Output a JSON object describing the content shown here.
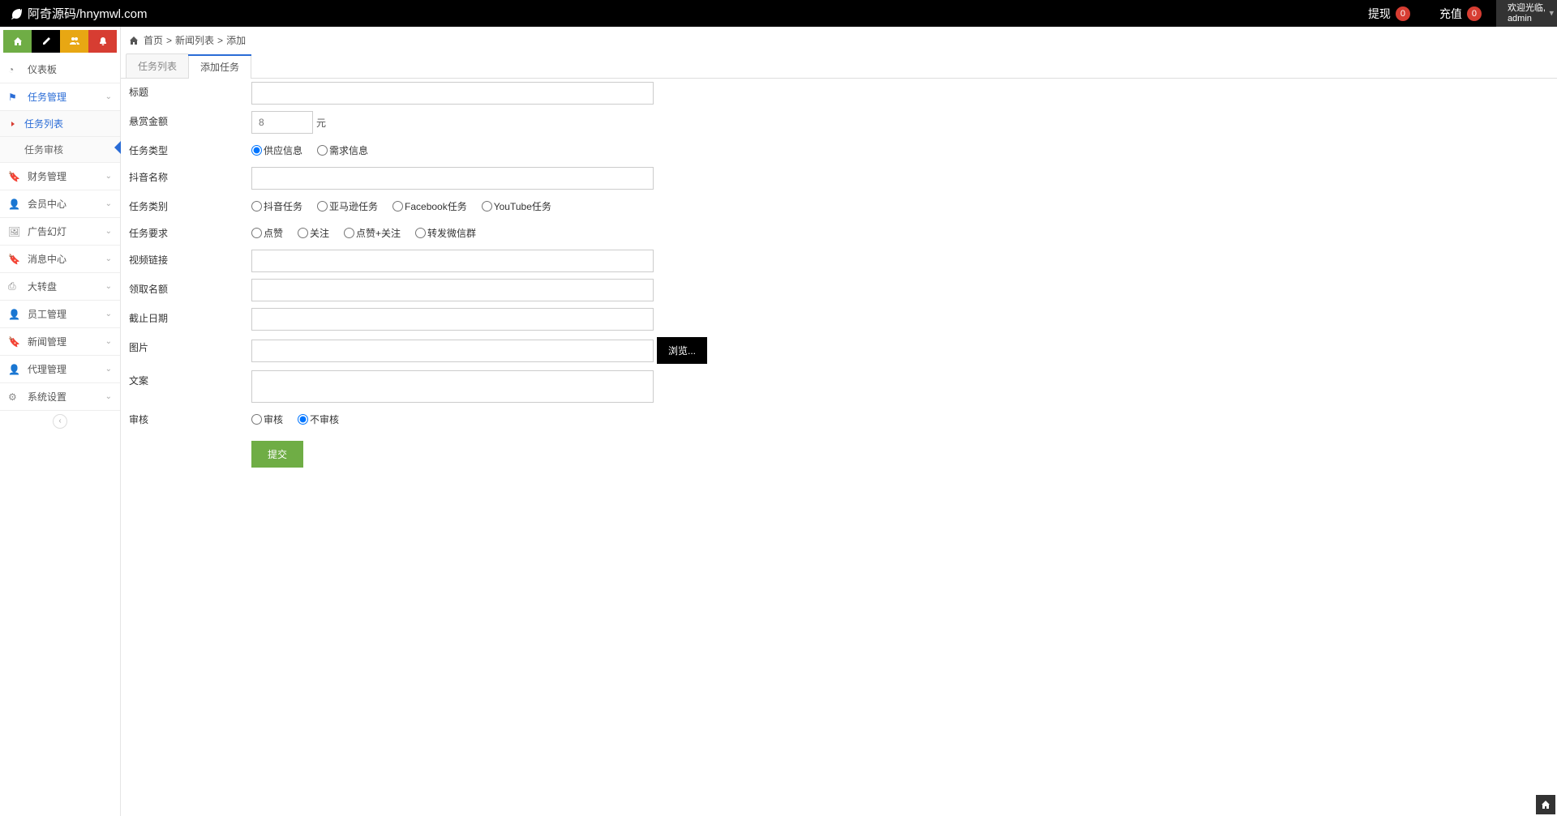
{
  "brand": "阿奇源码/hnymwl.com",
  "topbar": {
    "withdraw": "提现",
    "withdraw_count": "0",
    "recharge": "充值",
    "recharge_count": "0",
    "welcome": "欢迎光临,",
    "user": "admin"
  },
  "sidebar": {
    "items": [
      {
        "label": "仪表板",
        "icon": "dashboard",
        "expandable": false
      },
      {
        "label": "任务管理",
        "icon": "flag",
        "expandable": true,
        "active": true,
        "children": [
          {
            "label": "任务列表",
            "active": true
          },
          {
            "label": "任务审核",
            "active": false
          }
        ]
      },
      {
        "label": "财务管理",
        "icon": "bookmark",
        "expandable": true
      },
      {
        "label": "会员中心",
        "icon": "user",
        "expandable": true
      },
      {
        "label": "广告幻灯",
        "icon": "image",
        "expandable": true
      },
      {
        "label": "消息中心",
        "icon": "bookmark-o",
        "expandable": true
      },
      {
        "label": "大转盘",
        "icon": "print",
        "expandable": true
      },
      {
        "label": "员工管理",
        "icon": "user",
        "expandable": true
      },
      {
        "label": "新闻管理",
        "icon": "bookmark-o",
        "expandable": true
      },
      {
        "label": "代理管理",
        "icon": "user",
        "expandable": true
      },
      {
        "label": "系统设置",
        "icon": "gear",
        "expandable": true
      }
    ]
  },
  "breadcrumb": {
    "home": "首页",
    "sep": ">",
    "l1": "新闻列表",
    "l2": "添加"
  },
  "tabs": {
    "list": "任务列表",
    "add": "添加任务"
  },
  "form": {
    "title_label": "标题",
    "reward_label": "悬赏金额",
    "reward_placeholder": "8",
    "reward_unit": "元",
    "type_label": "任务类型",
    "type_options": [
      "供应信息",
      "需求信息"
    ],
    "douyin_name_label": "抖音名称",
    "category_label": "任务类别",
    "category_options": [
      "抖音任务",
      "亚马逊任务",
      "Facebook任务",
      "YouTube任务"
    ],
    "requirement_label": "任务要求",
    "requirement_options": [
      "点赞",
      "关注",
      "点赞+关注",
      "转发微信群"
    ],
    "video_link_label": "视频链接",
    "quota_label": "领取名额",
    "deadline_label": "截止日期",
    "image_label": "图片",
    "browse": "浏览...",
    "copy_label": "文案",
    "audit_label": "审核",
    "audit_options": [
      "审核",
      "不审核"
    ],
    "submit": "提交"
  }
}
